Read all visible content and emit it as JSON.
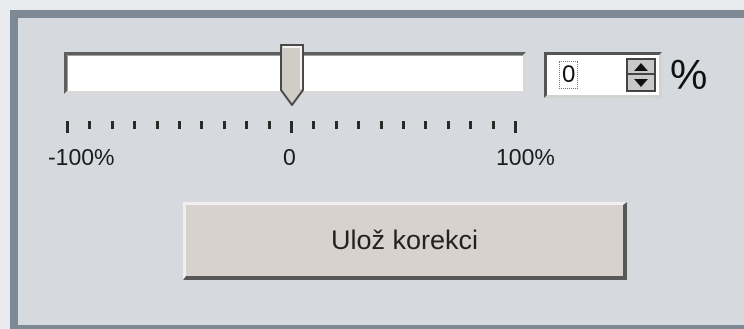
{
  "slider": {
    "min_label": "-100%",
    "mid_label": "0",
    "max_label": "100%",
    "min": -100,
    "max": 100,
    "value": 0,
    "tick_count": 21
  },
  "spinbox": {
    "value": "0",
    "unit": "%"
  },
  "save_button": {
    "label": "Ulož korekci"
  },
  "colors": {
    "panel_background": "#d6d9dd",
    "panel_border": "#7d8a96",
    "button_face": "#d7d2cd"
  },
  "icons": {
    "spin_up": "triangle-up-icon",
    "spin_down": "triangle-down-icon",
    "slider_thumb": "slider-thumb-icon"
  }
}
